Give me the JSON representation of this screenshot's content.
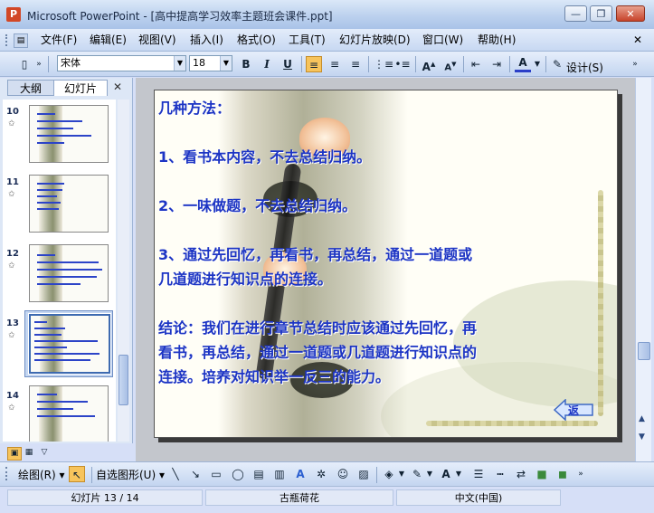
{
  "window": {
    "title": "Microsoft PowerPoint - [高中提高学习效率主题班会课件.ppt]",
    "app_icon": "powerpoint-icon",
    "controls": [
      "minimize-icon",
      "restore-icon",
      "close-icon"
    ]
  },
  "menu": {
    "items": [
      "文件(F)",
      "编辑(E)",
      "视图(V)",
      "插入(I)",
      "格式(O)",
      "工具(T)",
      "幻灯片放映(D)",
      "窗口(W)",
      "帮助(H)"
    ]
  },
  "toolbar": {
    "font_name": "宋体",
    "font_size": "18",
    "bold": "B",
    "italic": "I",
    "underline": "U",
    "design_label": "设计(S)"
  },
  "left_pane": {
    "tabs": [
      "大纲",
      "幻灯片"
    ],
    "slides": [
      {
        "number": "10"
      },
      {
        "number": "11"
      },
      {
        "number": "12"
      },
      {
        "number": "13",
        "selected": true
      },
      {
        "number": "14"
      }
    ]
  },
  "slide": {
    "lines": [
      "几种方法：",
      "1、看书本内容，不去总结归纳。",
      "2、一味做题，不去总结归纳。",
      "3、通过先回忆，再看书，再总结，通过一道题或",
      "几道题进行知识点的连接。",
      "结论：我们在进行章节总结时应该通过先回忆，再",
      "看书，再总结，通过一道题或几道题进行知识点的",
      "连接。培养对知识举一反三的能力。"
    ],
    "return_label": "返",
    "text_color": "#1d35c4"
  },
  "drawing_toolbar": {
    "draw_label": "绘图(R)",
    "autoshapes_label": "自选图形(U)"
  },
  "status": {
    "slide_position": "幻灯片 13 / 14",
    "design": "古瓶荷花",
    "language": "中文(中国)"
  }
}
